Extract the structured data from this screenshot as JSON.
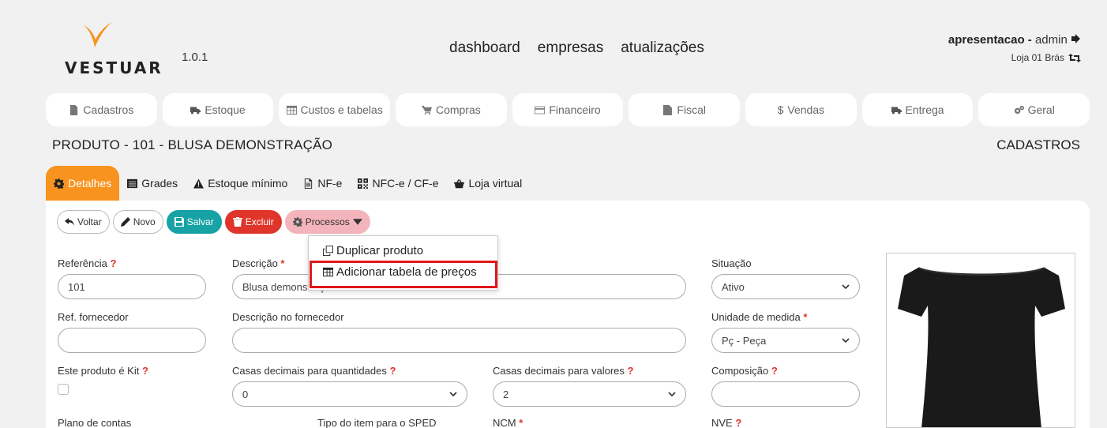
{
  "header": {
    "logo_text": "VESTUAR",
    "version": "1.0.1",
    "nav": [
      "dashboard",
      "empresas",
      "atualizações"
    ],
    "user_company": "apresentacao -",
    "user_name": "admin",
    "store": "Loja 01 Brás"
  },
  "menu": [
    {
      "label": "Cadastros",
      "icon": "file-icon"
    },
    {
      "label": "Estoque",
      "icon": "truck-icon"
    },
    {
      "label": "Custos e tabelas",
      "icon": "table-icon"
    },
    {
      "label": "Compras",
      "icon": "cart-icon"
    },
    {
      "label": "Financeiro",
      "icon": "credit-card-icon"
    },
    {
      "label": "Fiscal",
      "icon": "document-icon"
    },
    {
      "label": "Vendas",
      "icon": "dollar-icon",
      "prefix": "$"
    },
    {
      "label": "Entrega",
      "icon": "truck-icon"
    },
    {
      "label": "Geral",
      "icon": "cogs-icon"
    }
  ],
  "page": {
    "title": "PRODUTO - 101 - BLUSA DEMONSTRAÇÃO",
    "section": "CADASTROS"
  },
  "tabs": [
    {
      "label": "Detalhes",
      "active": true
    },
    {
      "label": "Grades"
    },
    {
      "label": "Estoque mínimo"
    },
    {
      "label": "NF-e"
    },
    {
      "label": "NFC-e / CF-e"
    },
    {
      "label": "Loja virtual"
    }
  ],
  "actions": {
    "back": "Voltar",
    "new": "Novo",
    "save": "Salvar",
    "delete": "Excluir",
    "processes": "Processos"
  },
  "dropdown": {
    "items": [
      "Duplicar produto",
      "Adicionar tabela de preços"
    ]
  },
  "form": {
    "referencia_label": "Referência",
    "referencia_value": "101",
    "descricao_label": "Descrição",
    "descricao_value": "Blusa demonstração",
    "situacao_label": "Situação",
    "situacao_value": "Ativo",
    "ref_fornecedor_label": "Ref. fornecedor",
    "ref_fornecedor_value": "",
    "descricao_fornecedor_label": "Descrição no fornecedor",
    "descricao_fornecedor_value": "",
    "unidade_label": "Unidade de medida",
    "unidade_value": "Pç - Peça",
    "kit_label": "Este produto é Kit",
    "casas_qtd_label": "Casas decimais para quantidades",
    "casas_qtd_value": "0",
    "casas_val_label": "Casas decimais para valores",
    "casas_val_value": "2",
    "composicao_label": "Composição",
    "composicao_value": "",
    "plano_label": "Plano de contas",
    "tipo_sped_label": "Tipo do item para o SPED",
    "ncm_label": "NCM",
    "nve_label": "NVE"
  },
  "colors": {
    "accent": "#f7931e",
    "save": "#17a2a5",
    "delete": "#e0352b",
    "processes": "#f4b4bb",
    "highlight": "#e0181b"
  }
}
